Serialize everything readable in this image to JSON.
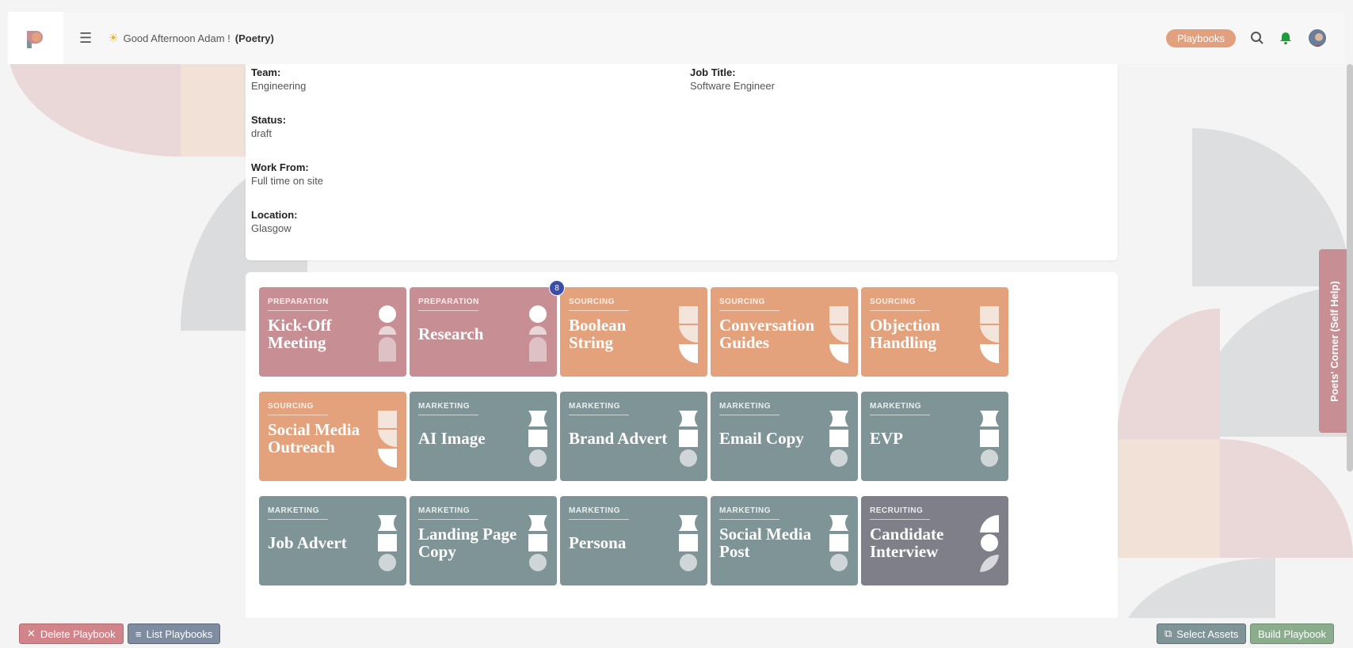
{
  "header": {
    "greeting": "Good Afternoon Adam !",
    "workspace": "(Poetry)",
    "playbooks_label": "Playbooks"
  },
  "details": {
    "team_label": "Team:",
    "team_value": "Engineering",
    "job_title_label": "Job Title:",
    "job_title_value": "Software Engineer",
    "status_label": "Status:",
    "status_value": "draft",
    "work_from_label": "Work From:",
    "work_from_value": "Full time on site",
    "location_label": "Location:",
    "location_value": "Glasgow"
  },
  "tiles": [
    {
      "category": "PREPARATION",
      "name_lines": [
        "Kick-Off",
        "Meeting"
      ]
    },
    {
      "category": "PREPARATION",
      "name_lines": [
        "Research"
      ],
      "badge": "8"
    },
    {
      "category": "SOURCING",
      "name_lines": [
        "Boolean",
        "String"
      ]
    },
    {
      "category": "SOURCING",
      "name_lines": [
        "Conversation",
        "Guides"
      ]
    },
    {
      "category": "SOURCING",
      "name_lines": [
        "Objection",
        "Handling"
      ]
    },
    {
      "category": "SOURCING",
      "name_lines": [
        "Social Media",
        "Outreach"
      ]
    },
    {
      "category": "MARKETING",
      "name_lines": [
        "AI Image"
      ]
    },
    {
      "category": "MARKETING",
      "name_lines": [
        "Brand Advert"
      ]
    },
    {
      "category": "MARKETING",
      "name_lines": [
        "Email Copy"
      ]
    },
    {
      "category": "MARKETING",
      "name_lines": [
        "EVP"
      ]
    },
    {
      "category": "MARKETING",
      "name_lines": [
        "Job Advert"
      ]
    },
    {
      "category": "MARKETING",
      "name_lines": [
        "Landing Page",
        "Copy"
      ]
    },
    {
      "category": "MARKETING",
      "name_lines": [
        "Persona"
      ]
    },
    {
      "category": "MARKETING",
      "name_lines": [
        "Social Media",
        "Post"
      ]
    },
    {
      "category": "RECRUITING",
      "name_lines": [
        "Candidate",
        "Interview"
      ]
    }
  ],
  "side_tab": "Poets' Corner (Self Help)",
  "footer": {
    "delete_label": "Delete Playbook",
    "list_label": "List Playbooks",
    "select_label": "Select Assets",
    "build_label": "Build Playbook"
  },
  "colors": {
    "preparation": "#c78f94",
    "sourcing": "#e3a27c",
    "marketing": "#7f9496",
    "recruiting": "#7e7f89",
    "accent": "#e2a07e"
  }
}
